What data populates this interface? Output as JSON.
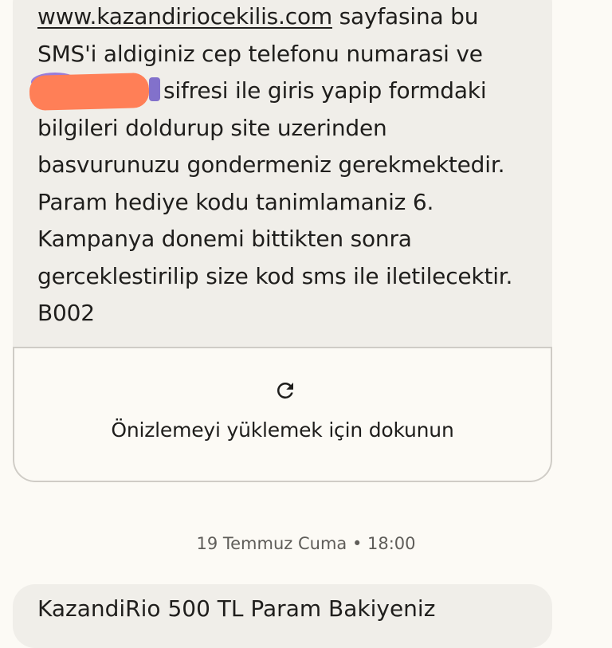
{
  "message": {
    "link": "www.kazandiriocekilis.com",
    "line1_rest": " sayfasina bu",
    "line2": "SMS'i aldiginiz cep telefonu numarasi ve",
    "line3_rest": "sifresi ile giris yapip formdaki",
    "line4": "bilgileri doldurup site uzerinden",
    "line5": "basvurunuzu gondermeniz gerekmektedir.",
    "line6": "Param hediye kodu tanimlamaniz 6.",
    "line7": "Kampanya donemi bittikten sonra",
    "line8": "gerceklestirilip size kod sms ile iletilecektir.",
    "line9": "B002"
  },
  "link_preview": {
    "icon": "refresh-icon",
    "label": "Önizlemeyi yüklemek için dokunun"
  },
  "timestamp": "19 Temmuz Cuma • 18:00",
  "next_message": {
    "text": "KazandiRio 500 TL Param Bakiyeniz"
  },
  "colors": {
    "background": "#fcfaf5",
    "bubble": "#f0eee9",
    "redaction": "#ff7f57"
  }
}
